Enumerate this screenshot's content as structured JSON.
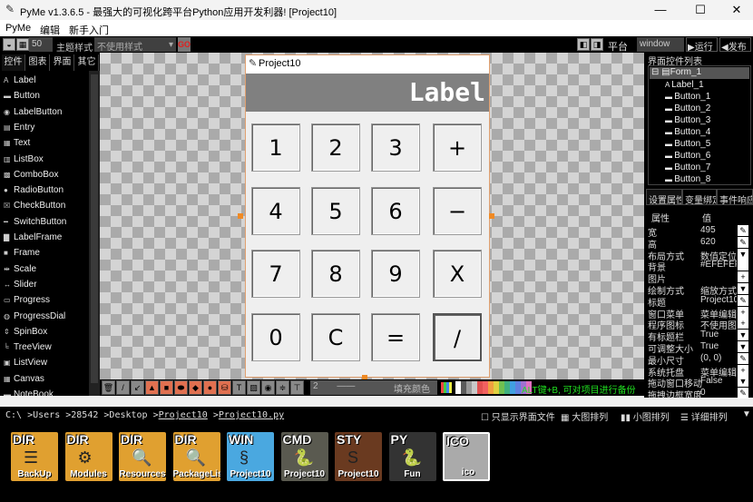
{
  "window": {
    "title": "PyMe v1.3.6.5 - 最强大的可视化跨平台Python应用开发利器!   [Project10]",
    "minimize": "—",
    "maximize": "☐",
    "close": "✕"
  },
  "menu": [
    "PyMe",
    "编辑",
    "新手入门"
  ],
  "toolbar": {
    "zoom": "50",
    "theme_label": "主题样式",
    "theme_value": "不使用样式",
    "go": "GO",
    "platform_label": "平台",
    "platform_value": "window",
    "run": "▶运行",
    "publish": "◀发布"
  },
  "left_tabs": [
    "控件",
    "图表",
    "界面",
    "其它"
  ],
  "widgets": [
    {
      "icon": "A",
      "label": "Label"
    },
    {
      "icon": "▬",
      "label": "Button"
    },
    {
      "icon": "◉",
      "label": "LabelButton"
    },
    {
      "icon": "▤",
      "label": "Entry"
    },
    {
      "icon": "▦",
      "label": "Text"
    },
    {
      "icon": "▥",
      "label": "ListBox"
    },
    {
      "icon": "▩",
      "label": "ComboBox"
    },
    {
      "icon": "●",
      "label": "RadioButton"
    },
    {
      "icon": "☒",
      "label": "CheckButton"
    },
    {
      "icon": "━",
      "label": "SwitchButton"
    },
    {
      "icon": "▇",
      "label": "LabelFrame"
    },
    {
      "icon": "■",
      "label": "Frame"
    },
    {
      "icon": "⇹",
      "label": "Scale"
    },
    {
      "icon": "↔",
      "label": "Slider"
    },
    {
      "icon": "▭",
      "label": "Progress"
    },
    {
      "icon": "◍",
      "label": "ProgressDial"
    },
    {
      "icon": "⇕",
      "label": "SpinBox"
    },
    {
      "icon": "╘",
      "label": "TreeView"
    },
    {
      "icon": "▣",
      "label": "ListView"
    },
    {
      "icon": "▦",
      "label": "Canvas"
    },
    {
      "icon": "▬",
      "label": "NoteBook"
    }
  ],
  "form": {
    "title": "Project10",
    "label": "Label",
    "buttons": [
      "1",
      "2",
      "3",
      "+",
      "4",
      "5",
      "6",
      "−",
      "7",
      "8",
      "9",
      "X",
      "0",
      "C",
      "=",
      "/"
    ]
  },
  "bottom_toolbar": {
    "line_width": "2",
    "fill": "填充颜色",
    "hint": "ALT键+B, 可对项目进行备份",
    "palette": [
      "#ffffff",
      "#5a5a5a",
      "#9a9a9a",
      "#c8c8c8",
      "#e05050",
      "#f06060",
      "#f0a040",
      "#e0d040",
      "#70c050",
      "#40b080",
      "#40a0e0",
      "#6080e0",
      "#a070d0",
      "#e070c0"
    ]
  },
  "tree": {
    "title": "界面控件列表",
    "root": "Form_1",
    "items": [
      "Label_1",
      "Button_1",
      "Button_2",
      "Button_3",
      "Button_4",
      "Button_5",
      "Button_6",
      "Button_7",
      "Button_8"
    ]
  },
  "right_tabs": [
    "设置属性",
    "变量绑定",
    "事件响应"
  ],
  "props": {
    "header_key": "属性",
    "header_val": "值",
    "rows": [
      {
        "k": "宽",
        "v": "495",
        "b": "✎"
      },
      {
        "k": "高",
        "v": "620",
        "b": "✎"
      },
      {
        "k": "布局方式",
        "v": "数值定位",
        "b": "▼"
      },
      {
        "k": "背景",
        "v": "#EFEFEF",
        "b": ""
      },
      {
        "k": "图片",
        "v": "",
        "b": "+"
      },
      {
        "k": "绘制方式",
        "v": "缩放方式",
        "b": "▼"
      },
      {
        "k": "标题",
        "v": "Project10",
        "b": "✎"
      },
      {
        "k": "窗口菜单",
        "v": "菜单编辑",
        "b": "+"
      },
      {
        "k": "程序图标",
        "v": "不使用图标",
        "b": "+"
      },
      {
        "k": "有标题栏",
        "v": "True",
        "b": "▼"
      },
      {
        "k": "可调整大小",
        "v": "True",
        "b": "▼"
      },
      {
        "k": "最小尺寸",
        "v": "(0, 0)",
        "b": "✎"
      },
      {
        "k": "系统托盘",
        "v": "菜单编辑",
        "b": "+"
      },
      {
        "k": "拖动窗口移动",
        "v": "False",
        "b": "▼"
      },
      {
        "k": "拖拽边框宽度",
        "v": "0",
        "b": "✎"
      }
    ]
  },
  "files": {
    "path": [
      "C:\\ ",
      ">Users ",
      ">28542 ",
      ">Desktop ",
      ">",
      "Project10",
      " >",
      "Project10.py"
    ],
    "only_ui": "只显示界面文件",
    "large": "大图排列",
    "small": "小图排列",
    "detail": "详细排列",
    "items": [
      {
        "tag": "DIR",
        "name": "BackUp",
        "color": "#e0a030",
        "icon": "☰"
      },
      {
        "tag": "DIR",
        "name": "Modules",
        "color": "#e0a030",
        "icon": "⚙"
      },
      {
        "tag": "DIR",
        "name": "Resources",
        "color": "#e0a030",
        "icon": "🔍"
      },
      {
        "tag": "DIR",
        "name": "PackageList",
        "color": "#e0a030",
        "icon": "🔍"
      },
      {
        "tag": "WIN",
        "name": "Project10",
        "color": "#4aa8e0",
        "icon": "§"
      },
      {
        "tag": "CMD",
        "name": "Project10",
        "color": "#5a5a50",
        "icon": "🐍"
      },
      {
        "tag": "STY",
        "name": "Project10",
        "color": "#6a3a20",
        "icon": "S"
      },
      {
        "tag": "PY",
        "name": "Fun",
        "color": "#333333",
        "icon": "🐍"
      },
      {
        "tag": "ICO",
        "name": "ico",
        "color": "#aaaaaa",
        "icon": ""
      }
    ]
  }
}
